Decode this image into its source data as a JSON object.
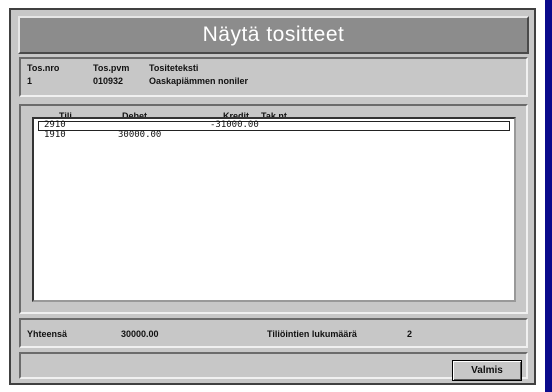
{
  "dialog": {
    "title": "Näytä tositteet"
  },
  "info": {
    "fields": [
      {
        "label": "Tos.nro",
        "value": "1"
      },
      {
        "label": "Tos.pvm",
        "value": "010932"
      },
      {
        "label": "Tositeteksti",
        "value": "Oaskapiämmen noniler"
      }
    ]
  },
  "table": {
    "columns": [
      "Tili",
      "Debet",
      "Kredit",
      "Tak nt"
    ],
    "rows": [
      {
        "account": "2910",
        "debit": "",
        "credit": "-31000.00",
        "selected": true
      },
      {
        "account": "1910",
        "debit": "30000.00",
        "credit": "",
        "selected": false
      }
    ]
  },
  "summary": {
    "total_label": "Yhteensä",
    "total_value": "30000.00",
    "rows_label": "Tiliöintien lukumäärä",
    "rows_value": "2"
  },
  "footer": {
    "button_label": "Valmis"
  }
}
